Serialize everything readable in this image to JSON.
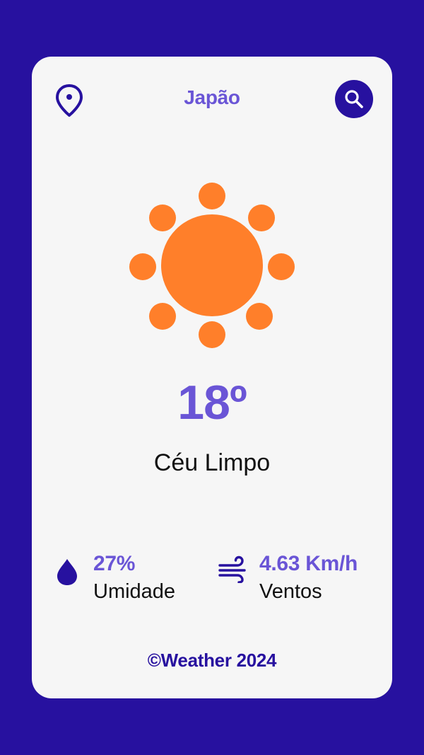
{
  "header": {
    "city": "Japão",
    "location_icon": "map-pin-icon",
    "search_icon": "search-icon"
  },
  "weather": {
    "icon": "sun-icon",
    "temperature": "18º",
    "description": "Céu Limpo"
  },
  "stats": {
    "humidity": {
      "icon": "water-drop-icon",
      "value": "27%",
      "label": "Umidade"
    },
    "wind": {
      "icon": "wind-icon",
      "value": "4.63 Km/h",
      "label": "Ventos"
    }
  },
  "footer": {
    "text": "©Weather 2024"
  },
  "colors": {
    "background": "#27119f",
    "card": "#f6f6f6",
    "accent": "#6a55d6",
    "sun": "#ff7f2a",
    "dark_text": "#111111"
  }
}
